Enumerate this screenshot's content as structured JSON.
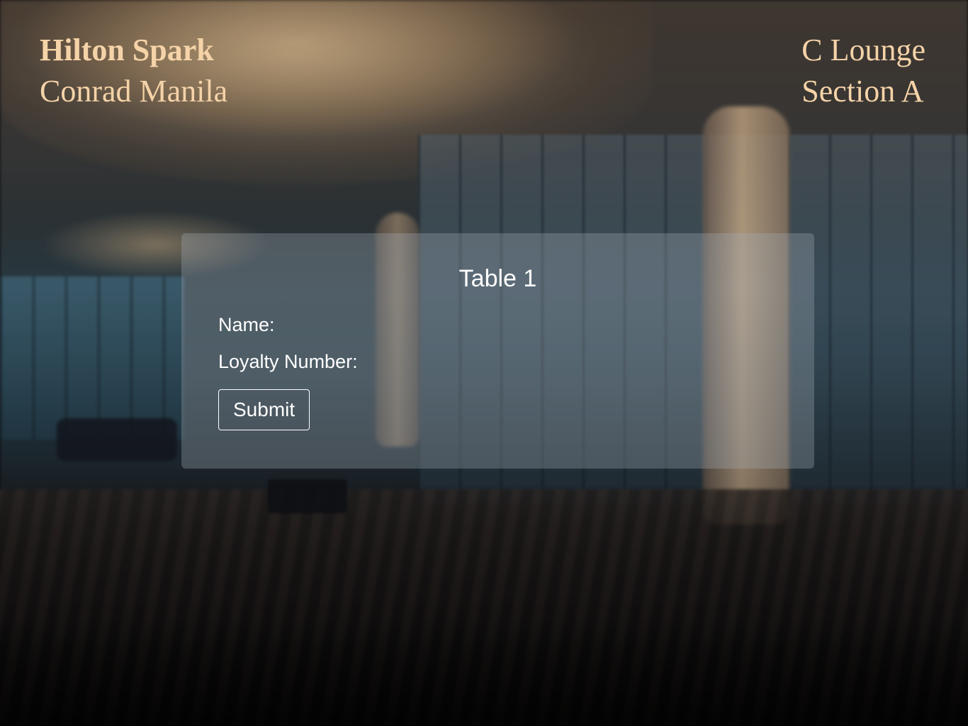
{
  "header": {
    "brand_name": "Hilton Spark",
    "property_name": "Conrad Manila",
    "venue_name": "C Lounge",
    "section_name": "Section A"
  },
  "form": {
    "title": "Table 1",
    "name_label": "Name:",
    "loyalty_label": "Loyalty Number:",
    "submit_label": "Submit"
  },
  "colors": {
    "brand_text": "#f5d3a8",
    "card_text": "#ffffff"
  }
}
